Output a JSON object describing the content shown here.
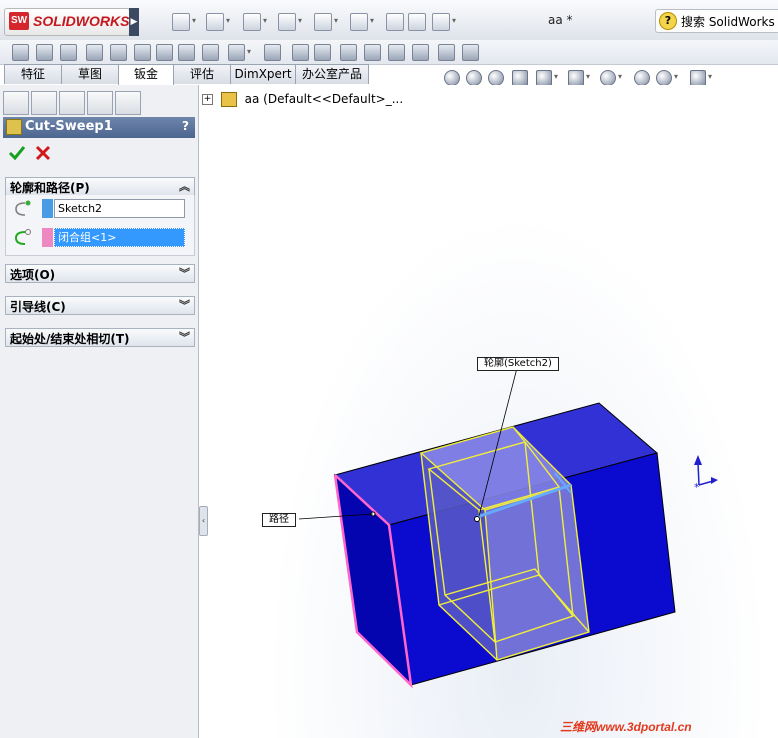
{
  "app": {
    "logo_text": "SOLIDWORKS",
    "logo_badge": "SW",
    "document_title": "aa *",
    "help_search": "搜索 SolidWorks 帮助"
  },
  "tabs": [
    {
      "label": "特征"
    },
    {
      "label": "草图"
    },
    {
      "label": "钣金"
    },
    {
      "label": "评估"
    },
    {
      "label": "DimXpert"
    },
    {
      "label": "办公室产品"
    }
  ],
  "active_tab": "钣金",
  "property_manager": {
    "title": "Cut-Sweep1",
    "help": "?",
    "sections": [
      {
        "label": "轮廓和路径(P)",
        "expanded": true
      },
      {
        "label": "选项(O)",
        "expanded": false
      },
      {
        "label": "引导线(C)",
        "expanded": false
      },
      {
        "label": "起始处/结束处相切(T)",
        "expanded": false
      }
    ],
    "profile_field": {
      "value": "Sketch2",
      "color": "#4a9be6"
    },
    "path_field": {
      "value": "闭合组<1>",
      "color": "#ee88c0",
      "selected": true
    }
  },
  "feature_tree": {
    "root_label": "aa  (Default<<Default>_..."
  },
  "viewport": {
    "callout_profile": "轮廓(Sketch2)",
    "callout_path": "路径",
    "part_color": "#1010d0",
    "preview_color": "#f2ef3a"
  },
  "watermark": "三维网www.3dportal.cn"
}
